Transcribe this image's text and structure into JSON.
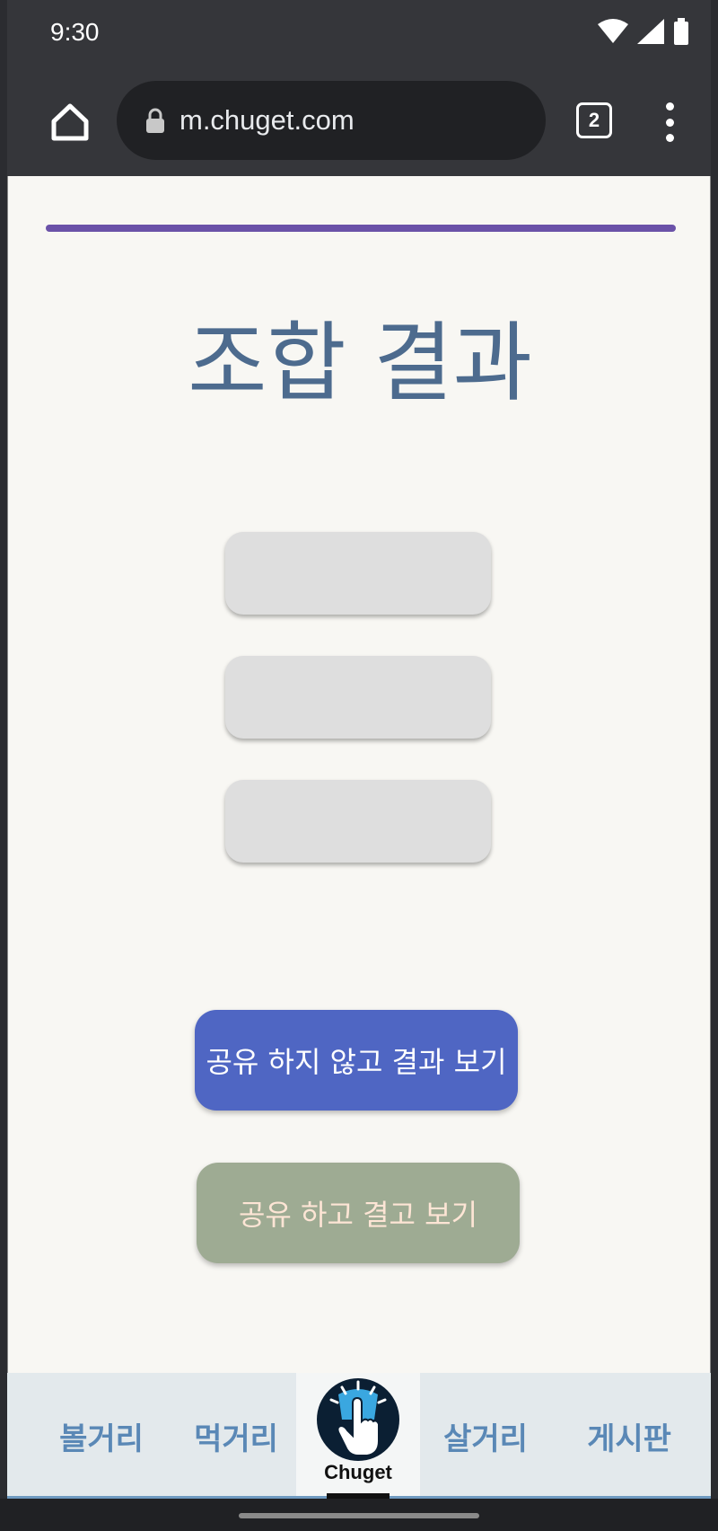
{
  "status_bar": {
    "time": "9:30"
  },
  "browser": {
    "url": "m.chuget.com",
    "tab_count": "2"
  },
  "page": {
    "title": "조합 결과",
    "result_slots": [
      "",
      "",
      ""
    ],
    "buttons": {
      "no_share": "공유 하지 않고 결과 보기",
      "share": "공유 하고 결고 보기"
    }
  },
  "bottom_nav": {
    "items": [
      "볼거리",
      "먹거리",
      "살거리",
      "게시판"
    ],
    "logo_text": "Chuget"
  },
  "colors": {
    "accent_line": "#6b52a8",
    "title": "#4d6b8e",
    "primary_button": "#4f66c3",
    "secondary_button": "#9eab93",
    "nav_text": "#5a88b6"
  }
}
